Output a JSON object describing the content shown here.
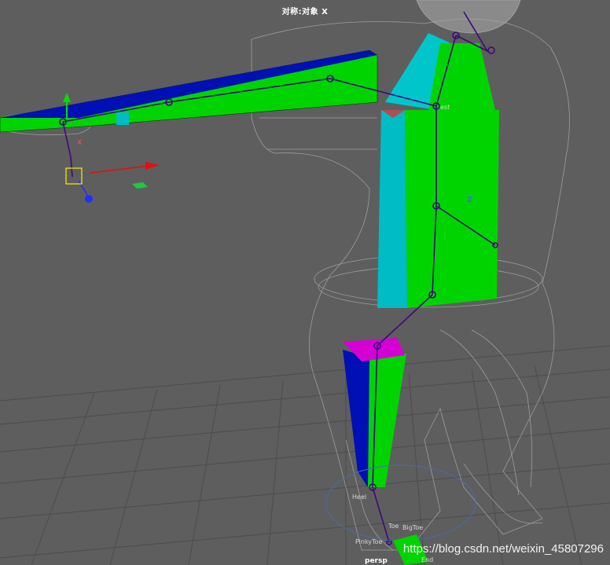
{
  "viewport": {
    "title": "对称:对象 X",
    "camera": "persp",
    "watermark": "https://blog.csdn.net/weixin_45807296"
  },
  "joint_labels": {
    "chest": "est",
    "heel": "Heel",
    "toe": "Toe",
    "big_toe": "BigToe",
    "pinky_toe": "PinkyToe",
    "end": "End"
  },
  "axis_labels": {
    "z": "Z",
    "x": "X"
  },
  "colors": {
    "background": "#5e5e5e",
    "grid": "#4a4a4a",
    "wireframe": "#9a9a9a",
    "part_green": "#00d400",
    "part_blue": "#0010b4",
    "part_cyan": "#00bcc4",
    "part_magenta": "#d400d4",
    "joint": "#3c0a78"
  },
  "icons": [
    "move-manipulator-icon",
    "head-sphere-icon"
  ]
}
